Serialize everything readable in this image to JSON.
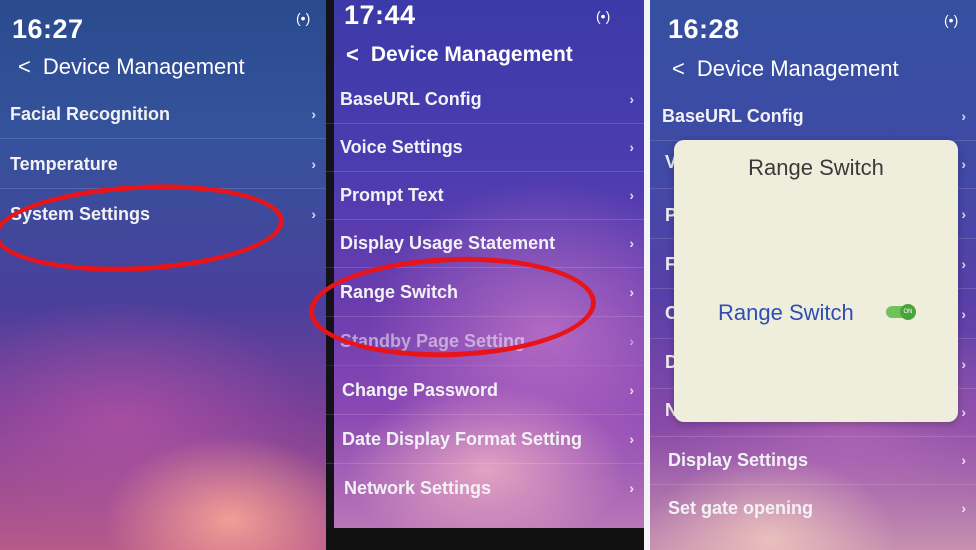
{
  "screens": [
    {
      "time": "16:27",
      "header": "Device Management",
      "items": [
        {
          "label": "Facial Recognition"
        },
        {
          "label": "Temperature"
        },
        {
          "label": "System Settings"
        }
      ]
    },
    {
      "time": "17:44",
      "header": "Device Management",
      "items": [
        {
          "label": "BaseURL Config"
        },
        {
          "label": "Voice Settings"
        },
        {
          "label": "Prompt Text"
        },
        {
          "label": "Display Usage Statement"
        },
        {
          "label": "Range Switch"
        },
        {
          "label": "Standby Page Setting"
        },
        {
          "label": "Change Password"
        },
        {
          "label": "Date Display Format Setting"
        },
        {
          "label": "Network Settings"
        }
      ]
    },
    {
      "time": "16:28",
      "header": "Device Management",
      "items": [
        {
          "label": "BaseURL Config"
        },
        {
          "label": "Display Settings"
        },
        {
          "label": "Set gate opening"
        }
      ],
      "dialog": {
        "title": "Range Switch",
        "option_label": "Range Switch",
        "toggle_text": "ON"
      }
    }
  ],
  "icons": {
    "back": "‹",
    "chevron": "›",
    "wifi": "(•)"
  },
  "colors": {
    "highlight": "#e8141a",
    "toggle_on": "#6fc35a",
    "dialog_label": "#2f4db3"
  }
}
